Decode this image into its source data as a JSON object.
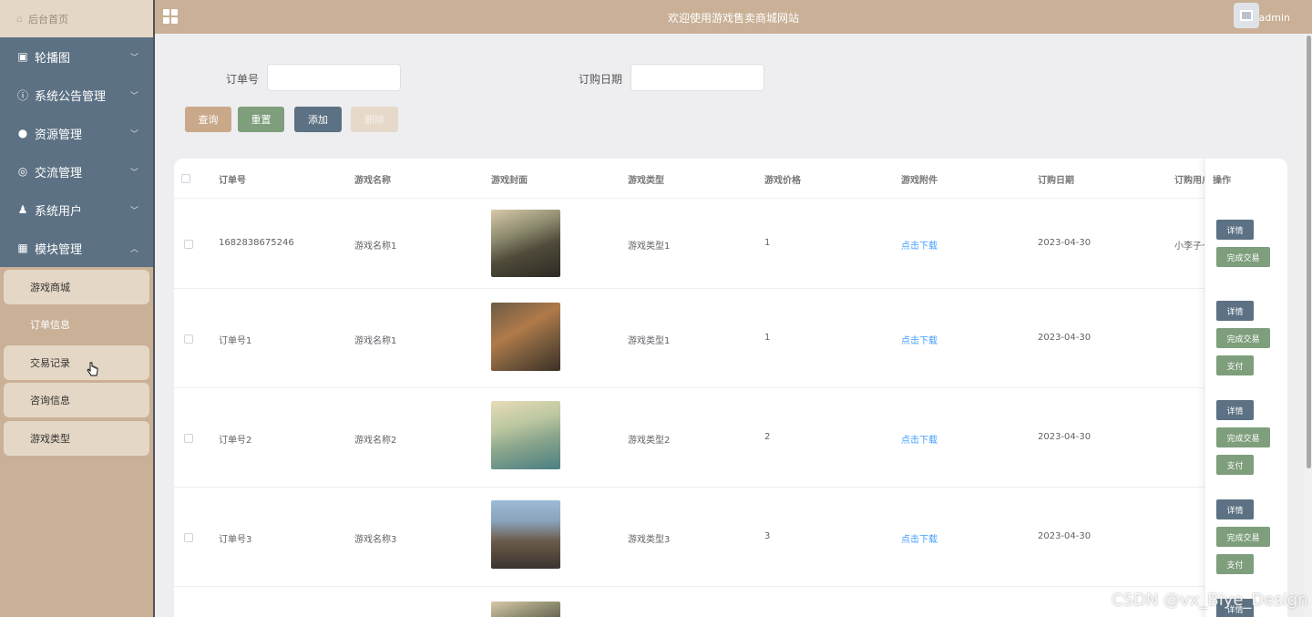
{
  "sidebar": {
    "home_label": "后台首页",
    "menu": [
      {
        "label": "轮播图",
        "icon": "picture-icon",
        "glyph": "🖼"
      },
      {
        "label": "系统公告管理",
        "icon": "info-icon",
        "glyph": "ⓘ"
      },
      {
        "label": "资源管理",
        "icon": "bulb-icon",
        "glyph": "●"
      },
      {
        "label": "交流管理",
        "icon": "chat-icon",
        "glyph": "☺"
      },
      {
        "label": "系统用户",
        "icon": "user-icon",
        "glyph": "♟"
      },
      {
        "label": "模块管理",
        "icon": "grid-icon",
        "glyph": "■"
      }
    ],
    "submenu": [
      "游戏商城",
      "订单信息",
      "交易记录",
      "咨询信息",
      "游戏类型"
    ]
  },
  "header": {
    "title": "欢迎使用游戏售卖商城网站",
    "user": "admin"
  },
  "search": {
    "order_label": "订单号",
    "date_label": "订购日期",
    "buttons": {
      "query": "查询",
      "reset": "重置",
      "add": "添加",
      "delete": "删除"
    }
  },
  "table": {
    "headers": [
      "订单号",
      "游戏名称",
      "游戏封面",
      "游戏类型",
      "游戏价格",
      "游戏附件",
      "订购日期",
      "订购用户",
      "操作"
    ],
    "rows": [
      {
        "order_no": "1682838675246",
        "name": "游戏名称1",
        "type": "游戏类型1",
        "price": "1",
        "attachment": "点击下载",
        "date": "2023-04-30",
        "user": "小李子一"
      },
      {
        "order_no": "订单号1",
        "name": "游戏名称1",
        "type": "游戏类型1",
        "price": "1",
        "attachment": "点击下载",
        "date": "2023-04-30",
        "user": ""
      },
      {
        "order_no": "订单号2",
        "name": "游戏名称2",
        "type": "游戏类型2",
        "price": "2",
        "attachment": "点击下载",
        "date": "2023-04-30",
        "user": ""
      },
      {
        "order_no": "订单号3",
        "name": "游戏名称3",
        "type": "游戏类型3",
        "price": "3",
        "attachment": "点击下载",
        "date": "2023-04-30",
        "user": ""
      }
    ],
    "op_labels": {
      "detail": "详情",
      "complete": "完成交易",
      "pay": "支付"
    }
  },
  "watermark": "CSDN @vx_Biye_Design",
  "colors": {
    "accent": "#c9b096",
    "sidebar_menu": "#5c7183",
    "reset_green": "#7e9e7c",
    "link": "#409eff"
  }
}
